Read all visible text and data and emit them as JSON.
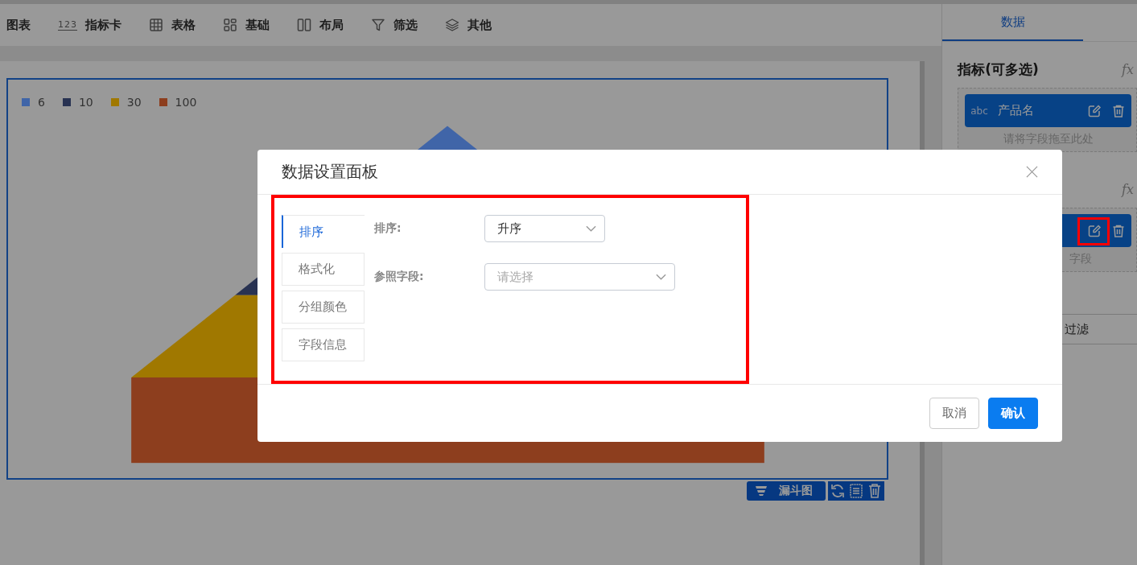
{
  "toolbar": {
    "items": [
      {
        "label": "图表",
        "kind": "none"
      },
      {
        "label": "指标卡",
        "kind": "number",
        "glyph": "123"
      },
      {
        "label": "表格",
        "kind": "grid"
      },
      {
        "label": "基础",
        "kind": "blocks"
      },
      {
        "label": "布局",
        "kind": "columns"
      },
      {
        "label": "筛选",
        "kind": "filter"
      },
      {
        "label": "其他",
        "kind": "layers"
      }
    ]
  },
  "chart": {
    "legend": [
      {
        "label": "6",
        "color": "#4065a8"
      },
      {
        "label": "10",
        "color": "#283252"
      },
      {
        "label": "30",
        "color": "#a07800"
      },
      {
        "label": "100",
        "color": "#8d3e1e"
      }
    ],
    "type_label": "漏斗图"
  },
  "side_panel": {
    "tabs": [
      {
        "label": "数据",
        "selected": true
      }
    ],
    "sections": [
      {
        "title": "指标(可多选)",
        "formula_icon": "fx",
        "fields": [
          {
            "kind": "field",
            "type": "abc",
            "name": "产品名"
          }
        ],
        "placeholder": "请将字段拖至此处"
      },
      {
        "formula_icon": "fx",
        "fields": [
          {
            "kind": "field"
          }
        ],
        "placeholder": "字段"
      }
    ],
    "filter_label": "过滤"
  },
  "dialog": {
    "title": "数据设置面板",
    "tabs": [
      {
        "label": "排序",
        "selected": true
      },
      {
        "label": "格式化",
        "selected": false
      },
      {
        "label": "分组颜色",
        "selected": false
      },
      {
        "label": "字段信息",
        "selected": false
      }
    ],
    "form": [
      {
        "label": "排序:",
        "value": "升序"
      },
      {
        "label": "参照字段:",
        "placeholder": "请选择"
      }
    ],
    "buttons": [
      {
        "label": "取消",
        "kind": "secondary"
      },
      {
        "label": "确认",
        "kind": "primary"
      }
    ]
  }
}
